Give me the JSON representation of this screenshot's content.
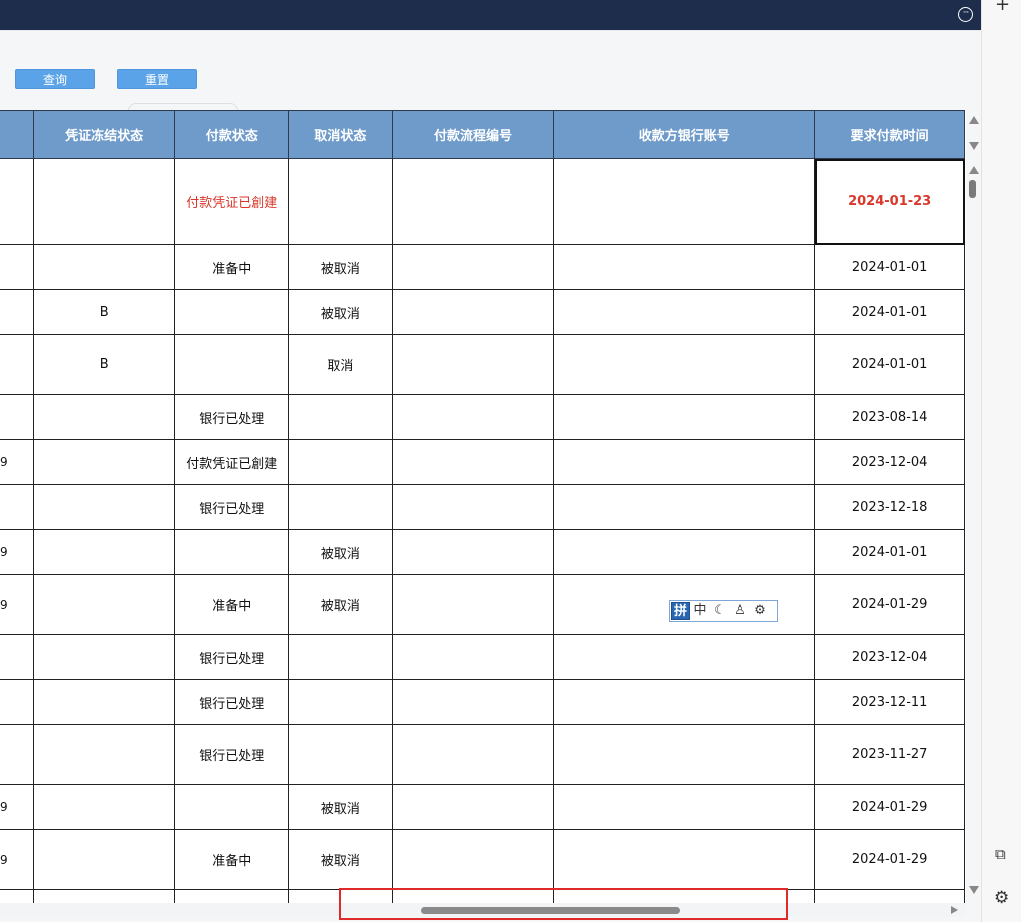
{
  "toolbar": {
    "query_label": "查询",
    "reset_label": "重置"
  },
  "table": {
    "columns": [
      {
        "key": "c0",
        "label": ""
      },
      {
        "key": "c1",
        "label": "凭证冻结状态"
      },
      {
        "key": "c2",
        "label": "付款状态"
      },
      {
        "key": "c3",
        "label": "取消状态"
      },
      {
        "key": "c4",
        "label": "付款流程编号"
      },
      {
        "key": "c5",
        "label": "收款方银行账号"
      },
      {
        "key": "c6",
        "label": "要求付款时间"
      }
    ],
    "rows": [
      {
        "frag": "",
        "freeze": "",
        "pay_status": "付款凭证已創建",
        "cancel": "",
        "flow": "",
        "account": "",
        "date": "2024-01-23"
      },
      {
        "frag": "",
        "freeze": "",
        "pay_status": "准备中",
        "cancel": "被取消",
        "flow": "",
        "account": "",
        "date": "2024-01-01"
      },
      {
        "frag": "",
        "freeze": "B",
        "pay_status": "",
        "cancel": "被取消",
        "flow": "",
        "account": "",
        "date": "2024-01-01"
      },
      {
        "frag": "",
        "freeze": "B",
        "pay_status": "",
        "cancel": "取消",
        "flow": "",
        "account": "",
        "date": "2024-01-01"
      },
      {
        "frag": "",
        "freeze": "",
        "pay_status": "银行已处理",
        "cancel": "",
        "flow": "",
        "account": "",
        "date": "2023-08-14"
      },
      {
        "frag": "9",
        "freeze": "",
        "pay_status": "付款凭证已創建",
        "cancel": "",
        "flow": "",
        "account": "",
        "date": "2023-12-04"
      },
      {
        "frag": "",
        "freeze": "",
        "pay_status": "银行已处理",
        "cancel": "",
        "flow": "",
        "account": "",
        "date": "2023-12-18"
      },
      {
        "frag": "9",
        "freeze": "",
        "pay_status": "",
        "cancel": "被取消",
        "flow": "",
        "account": "",
        "date": "2024-01-01"
      },
      {
        "frag": "9",
        "freeze": "",
        "pay_status": "准备中",
        "cancel": "被取消",
        "flow": "",
        "account": "",
        "date": "2024-01-29"
      },
      {
        "frag": "",
        "freeze": "",
        "pay_status": "银行已处理",
        "cancel": "",
        "flow": "",
        "account": "",
        "date": "2023-12-04"
      },
      {
        "frag": "",
        "freeze": "",
        "pay_status": "银行已处理",
        "cancel": "",
        "flow": "",
        "account": "",
        "date": "2023-12-11"
      },
      {
        "frag": "",
        "freeze": "",
        "pay_status": "银行已处理",
        "cancel": "",
        "flow": "",
        "account": "",
        "date": "2023-11-27"
      },
      {
        "frag": "9",
        "freeze": "",
        "pay_status": "",
        "cancel": "被取消",
        "flow": "",
        "account": "",
        "date": "2024-01-29"
      },
      {
        "frag": "9",
        "freeze": "",
        "pay_status": "准备中",
        "cancel": "被取消",
        "flow": "",
        "account": "",
        "date": "2024-01-29"
      },
      {
        "frag": "",
        "freeze": "",
        "pay_status": "",
        "cancel": "",
        "flow": "",
        "account": "",
        "date": ""
      }
    ]
  },
  "ime": {
    "pin": "拼",
    "zhong": "中",
    "moon": "☾",
    "user": "♙",
    "gear": "⚙"
  },
  "colors": {
    "header_bg": "#6e9bca",
    "top_bar": "#1e2d4b",
    "highlight_red": "#d9372b",
    "button": "#5ba3e8"
  }
}
